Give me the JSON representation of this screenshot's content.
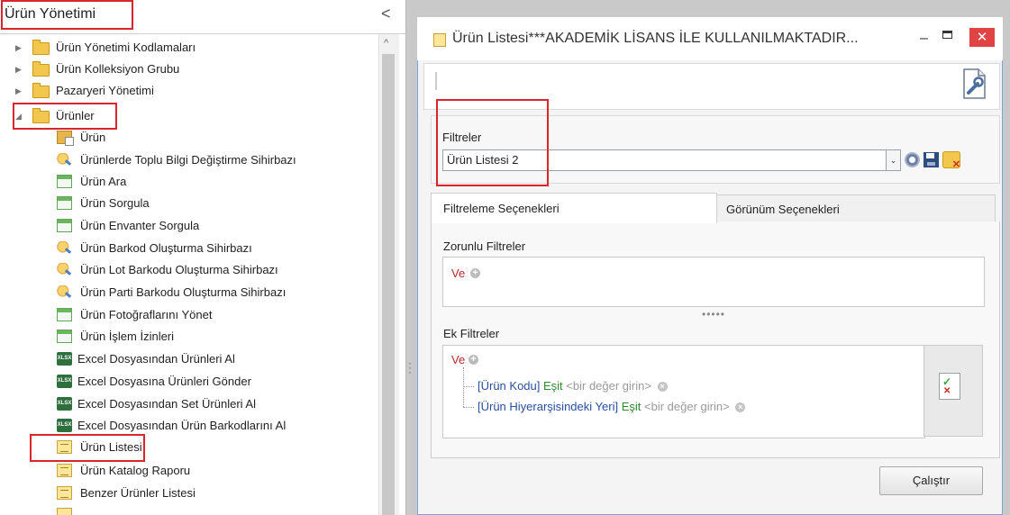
{
  "left_panel": {
    "title": "Ürün Yönetimi",
    "collapse_glyph": "<",
    "scroll_up_glyph": "^",
    "tree": [
      {
        "label": "Ürün Yönetimi Kodlamaları",
        "icon": "folder-icon",
        "level": 0,
        "state": "collapsed"
      },
      {
        "label": "Ürün Kolleksiyon Grubu",
        "icon": "folder-icon",
        "level": 0,
        "state": "collapsed"
      },
      {
        "label": "Pazaryeri Yönetimi",
        "icon": "folder-icon",
        "level": 0,
        "state": "collapsed"
      },
      {
        "label": "Ürünler",
        "icon": "folder-icon",
        "level": 0,
        "state": "expanded"
      },
      {
        "label": "Ürün",
        "icon": "product-icon",
        "level": 1
      },
      {
        "label": "Ürünlerde Toplu Bilgi Değiştirme Sihirbazı",
        "icon": "wizard-icon",
        "level": 1
      },
      {
        "label": "Ürün Ara",
        "icon": "form-icon",
        "level": 1
      },
      {
        "label": "Ürün Sorgula",
        "icon": "form-icon",
        "level": 1
      },
      {
        "label": "Ürün Envanter Sorgula",
        "icon": "form-icon",
        "level": 1
      },
      {
        "label": "Ürün Barkod Oluşturma Sihirbazı",
        "icon": "wizard-icon",
        "level": 1
      },
      {
        "label": "Ürün Lot Barkodu Oluşturma Sihirbazı",
        "icon": "wizard-icon",
        "level": 1
      },
      {
        "label": "Ürün Parti Barkodu Oluşturma Sihirbazı",
        "icon": "wizard-icon",
        "level": 1
      },
      {
        "label": "Ürün Fotoğraflarını Yönet",
        "icon": "form-icon",
        "level": 1
      },
      {
        "label": "Ürün İşlem İzinleri",
        "icon": "form-icon",
        "level": 1
      },
      {
        "label": "Excel Dosyasından Ürünleri Al",
        "icon": "excel-icon",
        "level": 1
      },
      {
        "label": "Excel Dosyasına Ürünleri Gönder",
        "icon": "excel-icon",
        "level": 1
      },
      {
        "label": "Excel Dosyasından Set Ürünleri Al",
        "icon": "excel-icon",
        "level": 1
      },
      {
        "label": "Excel Dosyasından Ürün Barkodlarını Al",
        "icon": "excel-icon",
        "level": 1
      },
      {
        "label": "Ürün Listesi",
        "icon": "list-report-icon",
        "level": 1
      },
      {
        "label": "Ürün Katalog Raporu",
        "icon": "list-report-icon",
        "level": 1
      },
      {
        "label": "Benzer Ürünler Listesi",
        "icon": "list-report-icon",
        "level": 1
      }
    ],
    "excel_badge": "XLSX"
  },
  "window": {
    "title": "Ürün Listesi***AKADEMİK LİSANS İLE KULLANILMAKTADIR...",
    "minimize_glyph": "–",
    "close_glyph": "✕",
    "filters_label": "Filtreler",
    "selected_filter": "Ürün Listesi 2",
    "dropdown_glyph": "⌄",
    "tabs": [
      {
        "label": "Filtreleme Seçenekleri",
        "active": true
      },
      {
        "label": "Görünüm Seçenekleri",
        "active": false
      }
    ],
    "required_filters_label": "Zorunlu Filtreler",
    "required_operator": "Ve",
    "splitter_glyph": "•••••",
    "additional_filters_label": "Ek Filtreler",
    "additional_operator": "Ve",
    "add_glyph": "+",
    "remove_glyph": "×",
    "conditions": [
      {
        "field": "[Ürün Kodu]",
        "operator": "Eşit",
        "value": "<bir değer girin>"
      },
      {
        "field": "[Ürün Hiyerarşisindeki Yeri]",
        "operator": "Eşit",
        "value": "<bir değer girin>"
      }
    ],
    "run_button": "Çalıştır"
  },
  "colors": {
    "highlight": "#d9262c",
    "close": "#e04343",
    "operator_red": "#c0282b",
    "field_blue": "#2a4da0",
    "eq_green": "#2e8b2e"
  }
}
